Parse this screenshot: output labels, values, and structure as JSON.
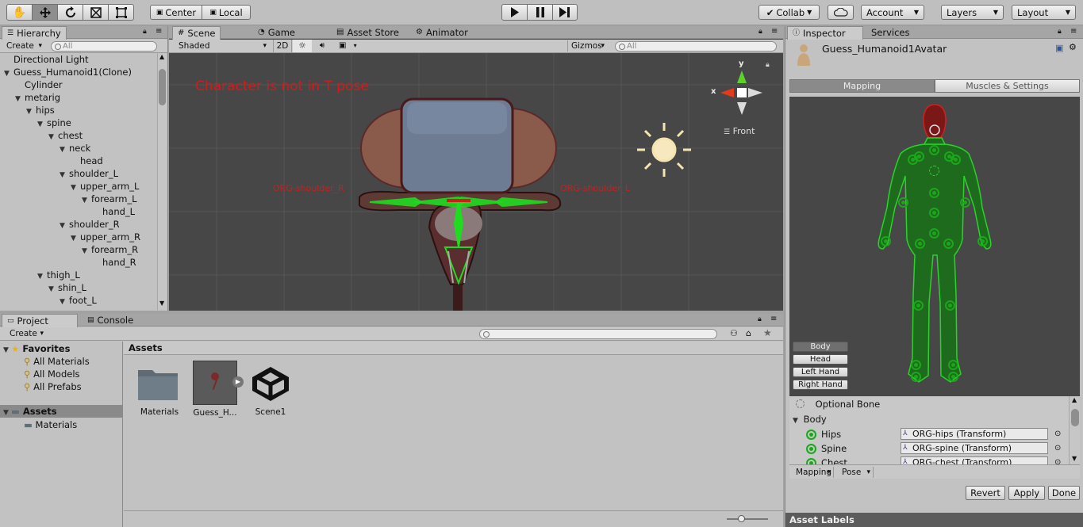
{
  "toolbar": {
    "pivot_center": "Center",
    "pivot_local": "Local",
    "collab": "Collab",
    "account": "Account",
    "layers": "Layers",
    "layout": "Layout"
  },
  "hierarchy": {
    "tab": "Hierarchy",
    "create": "Create",
    "search_placeholder": "All",
    "items": [
      {
        "label": "Directional Light",
        "depth": 0,
        "arrow": false
      },
      {
        "label": "Guess_Humanoid1(Clone)",
        "depth": 0,
        "arrow": true
      },
      {
        "label": "Cylinder",
        "depth": 1,
        "arrow": false
      },
      {
        "label": "metarig",
        "depth": 1,
        "arrow": true
      },
      {
        "label": "hips",
        "depth": 2,
        "arrow": true
      },
      {
        "label": "spine",
        "depth": 3,
        "arrow": true
      },
      {
        "label": "chest",
        "depth": 4,
        "arrow": true
      },
      {
        "label": "neck",
        "depth": 5,
        "arrow": true
      },
      {
        "label": "head",
        "depth": 6,
        "arrow": false
      },
      {
        "label": "shoulder_L",
        "depth": 5,
        "arrow": true
      },
      {
        "label": "upper_arm_L",
        "depth": 6,
        "arrow": true
      },
      {
        "label": "forearm_L",
        "depth": 7,
        "arrow": true
      },
      {
        "label": "hand_L",
        "depth": 8,
        "arrow": false
      },
      {
        "label": "shoulder_R",
        "depth": 5,
        "arrow": true
      },
      {
        "label": "upper_arm_R",
        "depth": 6,
        "arrow": true
      },
      {
        "label": "forearm_R",
        "depth": 7,
        "arrow": true
      },
      {
        "label": "hand_R",
        "depth": 8,
        "arrow": false
      },
      {
        "label": "thigh_L",
        "depth": 3,
        "arrow": true
      },
      {
        "label": "shin_L",
        "depth": 4,
        "arrow": true
      },
      {
        "label": "foot_L",
        "depth": 5,
        "arrow": true
      }
    ]
  },
  "scene": {
    "tabs": [
      "Scene",
      "Game",
      "Asset Store",
      "Animator"
    ],
    "shading": "Shaded",
    "mode_2d": "2D",
    "gizmos": "Gizmos",
    "search_placeholder": "All",
    "warning": "Character is not in T pose",
    "label_left": "ORG-shoulder_R",
    "label_right": "ORG-shoulder_L",
    "axis_y": "y",
    "axis_x": "x",
    "view": "Front"
  },
  "project": {
    "tabs": [
      "Project",
      "Console"
    ],
    "create": "Create",
    "favorites_title": "Favorites",
    "favorites": [
      "All Materials",
      "All Models",
      "All Prefabs"
    ],
    "assets_root": "Assets",
    "assets_children": [
      "Materials"
    ],
    "breadcrumb": "Assets",
    "items": [
      "Materials",
      "Guess_H...",
      "Scene1"
    ],
    "zoom": 0.33
  },
  "inspector": {
    "tabs": [
      "Inspector",
      "Services"
    ],
    "title": "Guess_Humanoid1Avatar",
    "subtabs": [
      "Mapping",
      "Muscles & Settings"
    ],
    "body_buttons": [
      "Body",
      "Head",
      "Left Hand",
      "Right Hand"
    ],
    "optional_bone": "Optional Bone",
    "section": "Body",
    "bones": [
      {
        "name": "Hips",
        "value": "ORG-hips (Transform)"
      },
      {
        "name": "Spine",
        "value": "ORG-spine (Transform)"
      },
      {
        "name": "Chest",
        "value": "ORG-chest (Transform)"
      }
    ],
    "mapping_dropdown": "Mapping",
    "pose_dropdown": "Pose",
    "revert": "Revert",
    "apply": "Apply",
    "done": "Done",
    "asset_labels": "Asset Labels"
  },
  "colors": {
    "scene_bg": "#474747",
    "warning": "#d41a1a",
    "bone_green": "#1fdc1f",
    "selection": "#8a8a8a"
  }
}
